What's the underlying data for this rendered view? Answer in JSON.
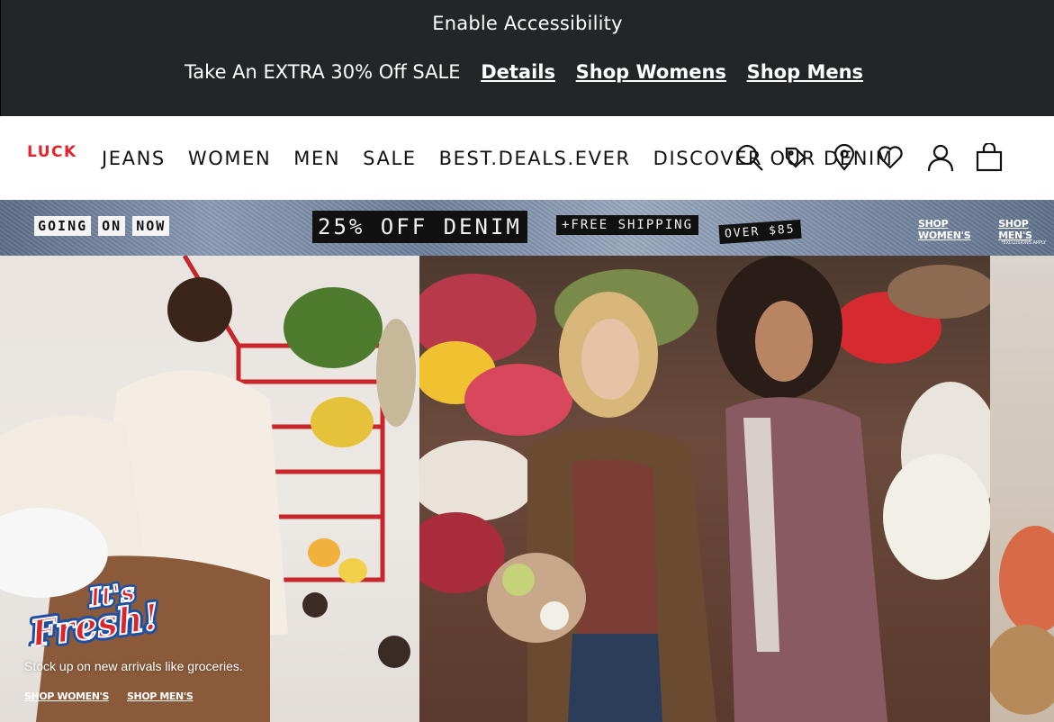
{
  "top_bar": {
    "accessibility_label": "Enable Accessibility",
    "promo_text": "Take An EXTRA 30% Off SALE",
    "links": [
      "Details",
      "Shop Womens",
      "Shop Mens"
    ]
  },
  "nav": {
    "logo": "LUCK",
    "links": [
      "JEANS",
      "WOMEN",
      "MEN",
      "SALE",
      "BEST.DEALS.EVER",
      "DISCOVER OUR DENIM"
    ],
    "icons": [
      "search-icon",
      "tag-icon",
      "location-pin-icon",
      "heart-icon",
      "account-icon",
      "shopping-bag-icon"
    ]
  },
  "denim_banner": {
    "going": [
      "GOING",
      "ON",
      "NOW"
    ],
    "headline": "25% OFF DENIM",
    "free_shipping": "+FREE SHIPPING",
    "over": "OVER $85",
    "shop_women": "SHOP WOMEN'S",
    "shop_men": "SHOP MEN'S",
    "exclusions": "*EXCLUSIONS APPLY"
  },
  "hero": {
    "logo_text": "It's Fresh!",
    "subtitle": "Stock up on new arrivals like groceries.",
    "shop_women": "SHOP WOMEN'S",
    "shop_men": "SHOP MEN'S"
  },
  "colors": {
    "top_bar_bg": "#232629",
    "logo_red": "#e4242a",
    "fresh_red": "#d9262c",
    "fresh_blue": "#1f4fa3"
  }
}
